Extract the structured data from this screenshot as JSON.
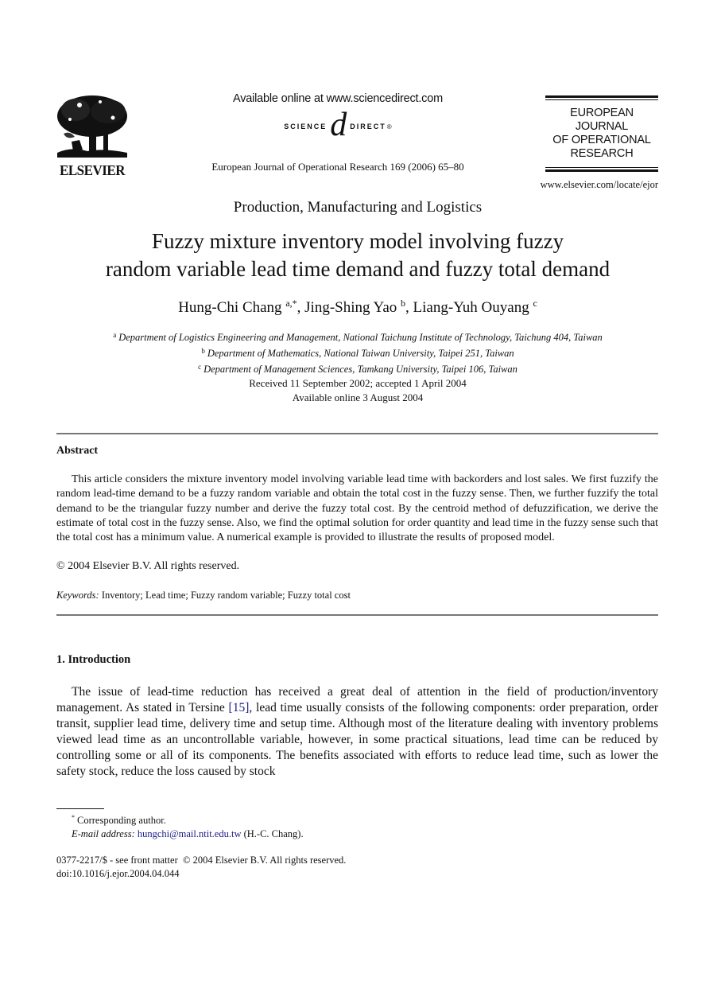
{
  "header": {
    "publisher_logo_text": "ELSEVIER",
    "available_online": "Available online at www.sciencedirect.com",
    "sciencedirect_left": "SCIENCE",
    "sciencedirect_at": "d",
    "sciencedirect_right": "DIRECT",
    "sciencedirect_reg": "®",
    "journal_reference": "European Journal of Operational Research 169 (2006) 65–80",
    "journal_box_lines": [
      "EUROPEAN",
      "JOURNAL",
      "OF OPERATIONAL",
      "RESEARCH"
    ],
    "journal_url": "www.elsevier.com/locate/ejor"
  },
  "article": {
    "section": "Production, Manufacturing and Logistics",
    "title_lines": [
      "Fuzzy mixture inventory model involving fuzzy",
      "random variable lead time demand and fuzzy total demand"
    ],
    "authors": [
      {
        "name": "Hung-Chi Chang",
        "marks": "a,*",
        "sep": ", "
      },
      {
        "name": "Jing-Shing Yao",
        "marks": "b",
        "sep": ", "
      },
      {
        "name": "Liang-Yuh Ouyang",
        "marks": "c",
        "sep": ""
      }
    ],
    "affiliations": [
      {
        "mark": "a",
        "text": "Department of Logistics Engineering and Management, National Taichung Institute of Technology, Taichung 404, Taiwan"
      },
      {
        "mark": "b",
        "text": "Department of Mathematics, National Taiwan University, Taipei 251, Taiwan"
      },
      {
        "mark": "c",
        "text": "Department of Management Sciences, Tamkang University, Taipei 106, Taiwan"
      }
    ],
    "received": "Received 11 September 2002; accepted 1 April 2004",
    "available": "Available online 3 August 2004"
  },
  "abstract": {
    "heading": "Abstract",
    "body": "This article considers the mixture inventory model involving variable lead time with backorders and lost sales. We first fuzzify the random lead-time demand to be a fuzzy random variable and obtain the total cost in the fuzzy sense. Then, we further fuzzify the total demand to be the triangular fuzzy number and derive the fuzzy total cost. By the centroid method of defuzzification, we derive the estimate of total cost in the fuzzy sense. Also, we find the optimal solution for order quantity and lead time in the fuzzy sense such that the total cost has a minimum value. A numerical example is provided to illustrate the results of proposed model.",
    "copyright": "© 2004 Elsevier B.V. All rights reserved.",
    "keywords_label": "Keywords:",
    "keywords": "Inventory; Lead time; Fuzzy random variable; Fuzzy total cost"
  },
  "introduction": {
    "heading": "1. Introduction",
    "body_before_cite": "The issue of lead-time reduction has received a great deal of attention in the field of production/inventory management. As stated in Tersine ",
    "cite": "[15]",
    "body_after_cite": ", lead time usually consists of the following components: order preparation, order transit, supplier lead time, delivery time and setup time. Although most of the literature dealing with inventory problems viewed lead time as an uncontrollable variable, however, in some practical situations, lead time can be reduced by controlling some or all of its components. The benefits associated with efforts to reduce lead time, such as lower the safety stock, reduce the loss caused by stock"
  },
  "footnotes": {
    "mark": "*",
    "corresponding": "Corresponding author.",
    "email_label": "E-mail address:",
    "email": "hungchi@mail.ntit.edu.tw",
    "email_owner": "(H.-C. Chang).",
    "front_matter": "0377-2217/$ - see front matter  © 2004 Elsevier B.V. All rights reserved.",
    "doi": "doi:10.1016/j.ejor.2004.04.044"
  }
}
